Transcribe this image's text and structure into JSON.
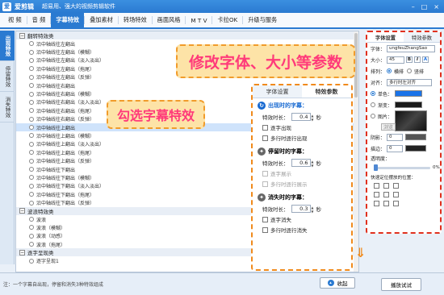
{
  "titlebar": {
    "app_name": "爱剪辑",
    "logo_glyph": "爱",
    "slogan": "超易用、强大的视频剪辑软件"
  },
  "menubar": {
    "tabs": [
      "视 频",
      "音 频",
      "字幕特效",
      "叠加素材",
      "转场特效",
      "画面风格",
      "M T V",
      "卡拉OK",
      "升级与服务"
    ],
    "active_index": 2
  },
  "side_tabs": [
    {
      "label": "出现特效",
      "active": true
    },
    {
      "label": "停留特效",
      "active": false
    },
    {
      "label": "消失特效",
      "active": false
    }
  ],
  "effect_list": {
    "groups": [
      {
        "header": "翻转特效类",
        "items": [
          "沿中轴线往左翻出",
          "沿中轴线往左翻出（模糊）",
          "沿中轴线往左翻出（淡入淡出）",
          "沿中轴线往左翻出（拖尾）",
          "沿中轴线往左翻出（反弹）",
          "沿中轴线往右翻出",
          "沿中轴线往右翻出（模糊）",
          "沿中轴线往右翻出（淡入淡出）",
          "沿中轴线往右翻出（拖尾）",
          "沿中轴线往右翻出（反弹）",
          "沿中轴线往上翻出",
          "沿中轴线往上翻出（模糊）",
          "沿中轴线往上翻出（淡入淡出）",
          "沿中轴线往上翻出（拖尾）",
          "沿中轴线往上翻出（反弹）",
          "沿中轴线往下翻出",
          "沿中轴线往下翻出（模糊）",
          "沿中轴线往下翻出（淡入淡出）",
          "沿中轴线往下翻出（拖尾）",
          "沿中轴线往下翻出（反弹）"
        ]
      },
      {
        "header": "波浪特效类",
        "items": [
          "波浪",
          "波浪（模糊）",
          "波浪（动感）",
          "波浪（拖尾）"
        ]
      },
      {
        "header": "逐字呈现类",
        "items": [
          "逐字呈现1"
        ]
      }
    ],
    "selected_item": "沿中轴线往上翻出"
  },
  "callouts": {
    "font_params": "修改字体、大小等参数",
    "pick_effect": "勾选字幕特效"
  },
  "timing_panel": {
    "tabs": [
      "字体设置",
      "特效参数"
    ],
    "active_tab": 1,
    "appear": {
      "heading": "出现时的字幕：",
      "duration_label": "特效时长：",
      "duration_value": "0.4",
      "unit": "秒",
      "options": [
        "逐字出现",
        "多行时逐行出现"
      ]
    },
    "stay": {
      "heading": "停留时的字幕：",
      "duration_label": "特效时长：",
      "duration_value": "0.6",
      "unit": "秒",
      "options": [
        "逐字展示",
        "多行时逐行展示"
      ]
    },
    "vanish": {
      "heading": "消失时的字幕：",
      "duration_label": "特效时长：",
      "duration_value": "0.3",
      "unit": "秒",
      "options": [
        "逐字消失",
        "多行时逐行消失"
      ]
    }
  },
  "properties": {
    "tabs": [
      "字体设置",
      "特效参数"
    ],
    "active_tab": 0,
    "font_label": "字体：",
    "font_value": "ungfeuZhangSao",
    "size_label": "大小：",
    "size_value": "45",
    "bold_label": "B",
    "italic_label": "I",
    "layout_label": "排列：",
    "horizontal_label": "横排",
    "vertical_label": "竖排",
    "align_label": "对齐：",
    "align_value": "多行时左对齐",
    "single_color_label": "单色：",
    "gradient_label": "渐变：",
    "image_label": "图片：",
    "browse_label": "浏览",
    "shadow_label": "阴影：",
    "shadow_value": "0",
    "stroke_label": "描边：",
    "stroke_value": "0",
    "opacity_label": "透明度：",
    "opacity_value": "0%",
    "position_label": "快速定位摆放的位置：",
    "colors": {
      "single": "#1a73e8",
      "gradient": "#1a1a1a"
    }
  },
  "status": {
    "hint": "注：一个字幕自出现，停留和消失3种特效组成",
    "collapse_label": "收起",
    "preview_label": "播放试试"
  }
}
